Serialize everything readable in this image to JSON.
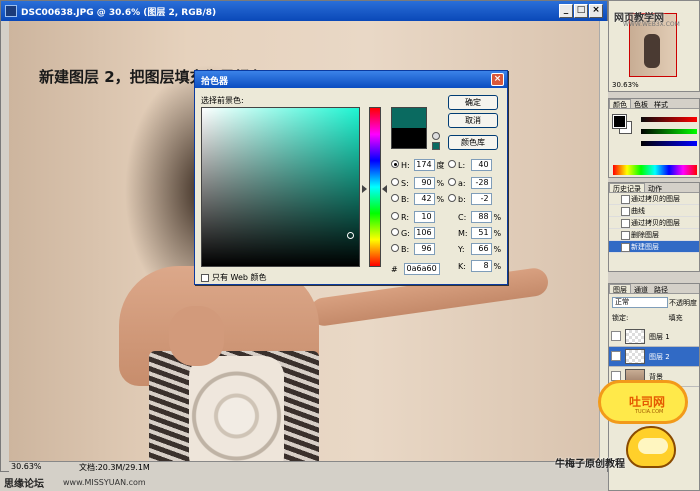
{
  "document": {
    "title": "DSC00638.JPG @ 30.6% (图层 2, RGB/8)",
    "heading": "新建图层 2，把图层填充为墨绿色",
    "status_zoom": "30.63%",
    "status_doc": "文档:20.3M/29.1M",
    "buttons": {
      "minimize": "_",
      "maximize": "□",
      "close": "×"
    }
  },
  "picker": {
    "title": "拾色器",
    "close": "×",
    "select_label": "选择前景色:",
    "ok": "确定",
    "cancel": "取消",
    "library": "颜色库",
    "web_only": "只有 Web 颜色",
    "fields": {
      "H": {
        "label": "H:",
        "value": "174",
        "unit": "度"
      },
      "S": {
        "label": "S:",
        "value": "90",
        "unit": "%"
      },
      "B": {
        "label": "B:",
        "value": "42",
        "unit": "%"
      },
      "R": {
        "label": "R:",
        "value": "10"
      },
      "G": {
        "label": "G:",
        "value": "106"
      },
      "Bl": {
        "label": "B:",
        "value": "96"
      },
      "L": {
        "label": "L:",
        "value": "40"
      },
      "a": {
        "label": "a:",
        "value": "-28"
      },
      "b": {
        "label": "b:",
        "value": "-2"
      },
      "C": {
        "label": "C:",
        "value": "88",
        "unit": "%"
      },
      "M": {
        "label": "M:",
        "value": "51",
        "unit": "%"
      },
      "Y": {
        "label": "Y:",
        "value": "66",
        "unit": "%"
      },
      "K": {
        "label": "K:",
        "value": "8",
        "unit": "%"
      },
      "hex": {
        "label": "#",
        "value": "0a6a60"
      }
    },
    "new_color": "#0a6a60"
  },
  "navigator": {
    "zoom": "30.63%",
    "site_banner": "网页教学网",
    "site_url": "WWW.WEB3X.COM"
  },
  "color_panel": {
    "tabs": [
      "颜色",
      "色板",
      "样式"
    ]
  },
  "history_panel": {
    "tabs": [
      "历史记录",
      "动作"
    ],
    "items": [
      "通过拷贝的图层",
      "曲线",
      "通过拷贝的图层",
      "删除图层",
      "新建图层"
    ]
  },
  "layers_panel": {
    "tabs": [
      "图层",
      "通道",
      "路径"
    ],
    "blend_mode": "正常",
    "opacity_label": "不透明度",
    "lock_label": "锁定:",
    "fill_label": "填充",
    "layers": [
      "图层 1",
      "图层 2",
      "背景"
    ]
  },
  "watermarks": {
    "mascot_name": "吐司网",
    "mascot_url": "TUCIA.COM",
    "credit": "牛梅子原创教程",
    "forum": "思缘论坛",
    "forum_url": "www.MISSYUAN.com"
  }
}
